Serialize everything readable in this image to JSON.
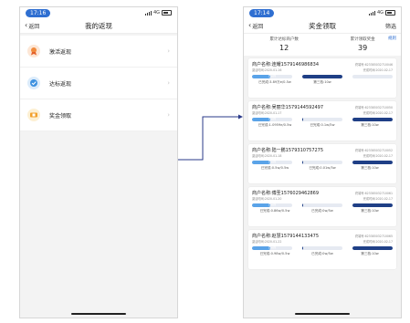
{
  "colors": {
    "primary": "#2f6fd1",
    "navy": "#1f3f86",
    "light_blue": "#5aa3e8"
  },
  "left": {
    "status": {
      "time": "17:16",
      "network": "4G"
    },
    "nav": {
      "back": "返回",
      "title": "我的返现"
    },
    "menu": [
      {
        "label": "激活返现",
        "icon": "medal-icon",
        "color": "#f08a3c"
      },
      {
        "label": "达标返现",
        "icon": "check-badge-icon",
        "color": "#3f92e0"
      },
      {
        "label": "奖金领取",
        "icon": "ticket-icon",
        "color": "#f2a12b"
      }
    ]
  },
  "right": {
    "status": {
      "time": "17:14",
      "network": "4G"
    },
    "nav": {
      "back": "返回",
      "title": "奖金领取",
      "filter": "筛选"
    },
    "rule": "规则",
    "stats": [
      {
        "label": "累计达标商户数",
        "value": "12"
      },
      {
        "label": "累计领取奖金",
        "value": "39"
      }
    ],
    "cards": [
      {
        "merchant": "商户名称:连耀1579146986834",
        "terminal": "终端号:623385032710046",
        "register": "激活时间:2020-01-16",
        "achieve": "完成时间:2020-02-17",
        "left_label": "已完成",
        "left_level": 0.45,
        "left_detail": "已完成:3.89万e/0.5w",
        "right_label": "",
        "right_level": 1.0,
        "right_detail": "第三档:10w"
      },
      {
        "merchant": "商户名称:吴丽华1579144592497",
        "terminal": "终端号:623385032710050",
        "register": "激活时间:2020-01-17",
        "achieve": "完成时间:2020-02-17",
        "left_label": "已完成",
        "left_level": 0.45,
        "left_detail": "已完成:1.0959e/0.5w",
        "right_label": "",
        "right_level": 0.02,
        "right_detail": "已完成:0.1w/5w",
        "third_label": "",
        "third_level": 1.0,
        "third_detail": "第三档:10w"
      },
      {
        "merchant": "商户名称:陆一鹏1579310757275",
        "terminal": "终端号:623385032710052",
        "register": "激活时间:2020-01-18",
        "achieve": "完成时间:2020-02-17",
        "left_label": "已完成",
        "left_level": 0.45,
        "left_detail": "已完成:0.5w/0.5w",
        "right_label": "",
        "right_level": 0.02,
        "right_detail": "已完成:0.01w/5w",
        "third_label": "",
        "third_level": 1.0,
        "third_detail": "第三档:10w"
      },
      {
        "merchant": "商户名称:傅圣1576029462869",
        "terminal": "终端号:623385032710061",
        "register": "激活时间:2020-01-20",
        "achieve": "完成时间:2020-02-17",
        "left_label": "已完成",
        "left_level": 0.45,
        "left_detail": "已完成:0.86w/0.5w",
        "right_label": "",
        "right_level": 0.02,
        "right_detail": "已完成:0w/5w",
        "third_label": "",
        "third_level": 1.0,
        "third_detail": "第三档:10w"
      },
      {
        "merchant": "商户名称:赵慧1579144133475",
        "terminal": "终端号:623385032710065",
        "register": "激活时间:2020-01-22",
        "achieve": "完成时间:2020-02-17",
        "left_label": "已完成",
        "left_level": 0.45,
        "left_detail": "已完成:0.98w/0.5w",
        "right_label": "",
        "right_level": 0.02,
        "right_detail": "已完成:0w/5w",
        "third_label": "",
        "third_level": 1.0,
        "third_detail": "第三档:10w"
      }
    ]
  }
}
